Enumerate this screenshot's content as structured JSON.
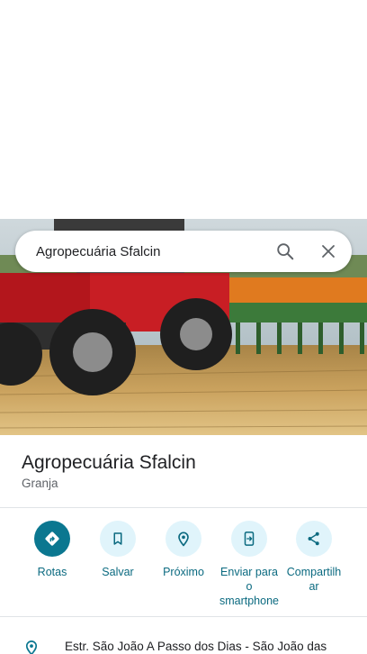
{
  "search": {
    "query": "Agropecuária Sfalcin"
  },
  "place": {
    "title": "Agropecuária Sfalcin",
    "category": "Granja"
  },
  "actions": [
    {
      "label": "Rotas",
      "icon": "directions-icon"
    },
    {
      "label": "Salvar",
      "icon": "bookmark-icon"
    },
    {
      "label": "Próximo",
      "icon": "nearby-icon"
    },
    {
      "label": "Enviar para o smartphone",
      "icon": "send-to-phone-icon"
    },
    {
      "label": "Compartilhar",
      "icon": "share-icon"
    }
  ],
  "address": {
    "text": "Estr. São João A Passo dos Dias - São João das"
  },
  "colors": {
    "accent": "#0b7790",
    "accent_light": "#e0f4fb",
    "action_text": "#0b6a80"
  }
}
